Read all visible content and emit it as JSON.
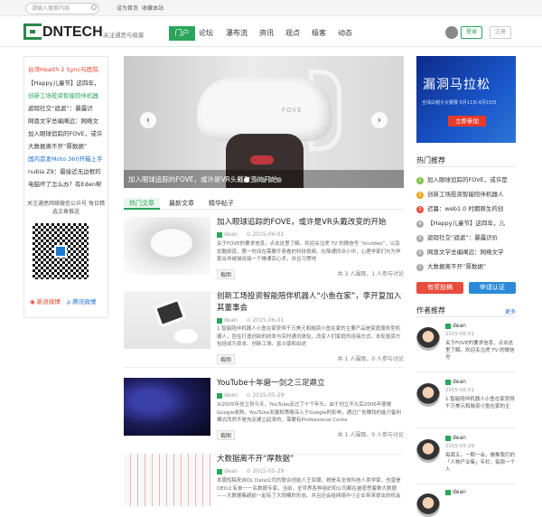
{
  "topbar": {
    "search_placeholder": "请输入搜索内容",
    "links": [
      "设为首页",
      "收藏本站"
    ]
  },
  "header": {
    "logo": "DNTECH",
    "slogan": "关注通思与极客",
    "nav": [
      "门户",
      "论坛",
      "瀑布流",
      "资讯",
      "观点",
      "极客",
      "动态"
    ],
    "login": "登录",
    "register": "注册"
  },
  "left": {
    "lines": [
      {
        "text": "台湾Health 2 Sync与医院",
        "color": "#e8422e"
      },
      {
        "text": "【Happy儿童节】这四年，",
        "color": "#333333"
      },
      {
        "text": "创新工场投资智能陪伴机器",
        "color": "#2aa55a"
      },
      {
        "text": "遮瑕社交“遮遮”：暴露识",
        "color": "#333333"
      },
      {
        "text": "网恩文学总编阐远：网络文",
        "color": "#333333"
      },
      {
        "text": "加入眼球追踪的FOVE，或许",
        "color": "#333333"
      },
      {
        "text": "大数据离不开“厚数据”",
        "color": "#333333"
      },
      {
        "text": "国内首发Moto 360开箱上手",
        "color": "#1b6fd0"
      },
      {
        "text": "nubia Z9：最接近无边框的",
        "color": "#333333"
      },
      {
        "text": "电脑坏了怎么办？有Eden帮",
        "color": "#333333"
      }
    ],
    "wechat_title": "关注通思网络微信公众号 每日精选文章推送",
    "weibo": "新浪微博",
    "tweibo": "腾讯微博"
  },
  "slider": {
    "caption": "加入眼球追踪的FOVE，或许是VR头戴改变的开始",
    "brand": "FOVE",
    "prev": "‹",
    "next": "›"
  },
  "tabs": [
    "热门文章",
    "最新文章",
    "精华帖子"
  ],
  "articles": [
    {
      "title": "加入眼球追踪的FOVE，或许是VR头戴改变的开始",
      "author": "dean",
      "date": "2015-06-01",
      "desc": "关于FOVE的要求信息，点击这里了解。欢迎关注虎 TV 的微信号 “knvideo”，以及优酷频道，第一时间在需要开奇看的科技视频。在降通同众小中，心理学家们与为学家合伴被描连接一个睡通实心术，并且习惯地",
      "tag": "截图",
      "stats": "共 3 人围观，1 人参与讨论"
    },
    {
      "title": "创新工场投资智能陪伴机器人“小鱼在家”，李开复加入其董事会",
      "author": "dean",
      "date": "2015-06-01",
      "desc": "1.智能陪伴机器人小鱼在家获得千万美元和融资小鱼在家的主要产品是家庭服务型机器人，旨在打造创新的研发与实时通讯体验，改变人们家庭的连接方式。本轮投资方包括成为资本、创新工场、富士康和出途",
      "tag": "截图",
      "stats": "共 1 人围观，0 人参与讨论"
    },
    {
      "title": "YouTube十年磨一剑之三足鼎立",
      "author": "dean",
      "date": "2015-05-29",
      "desc": "从2005年创立到今天，YouTube走过了十个年头。由于创立不久后2006年便被Google收购，YouTube发展和策略深入于Google的影响，通过广告赚钱的能力备利模式而然不是充足建立起来的，需要有Professional Conte",
      "tag": "截图",
      "stats": "共 1 人围观，0 人参与讨论"
    },
    {
      "title": "大数据离不开“厚数据”",
      "author": "dean",
      "date": "2015-05-29",
      "desc": "本篇短稿来自DL Data公司的联合创始人王亚娜，她是名全球科技人类学家，也曾是DEO上有单一一名数据专家。当前，全世界各种组织和公司都在被密思着数大数据——大数据集超前一起有了大规模的形态。并且还会给网络中小企业带来提出的机会",
      "tag": "截图",
      "stats": ""
    }
  ],
  "ad": {
    "title": "漏洞马拉松",
    "sub": "全球白帽子大赛赛 5月11日-6月15日",
    "cta": "立即参加"
  },
  "hot": {
    "heading": "热门推荐",
    "items": [
      {
        "n": "1",
        "text": "加入眼球追踪的FOVE，或许是",
        "c": "#7cc242"
      },
      {
        "n": "2",
        "text": "创新工场投资智能陪伴机器人",
        "c": "#f3a21b"
      },
      {
        "n": "3",
        "text": "迟暮：web1.0 时期原生的创",
        "c": "#e84c3d"
      },
      {
        "n": "4",
        "text": "【Happy儿童节】这四年，儿",
        "c": "#aaaaaa"
      },
      {
        "n": "5",
        "text": "遮瑕社交“遮遮”：暴露识价",
        "c": "#aaaaaa"
      },
      {
        "n": "6",
        "text": "网恩文学总编阐远：网络文学",
        "c": "#aaaaaa"
      },
      {
        "n": "7",
        "text": "大数据离不开“厚数据”",
        "c": "#aaaaaa"
      }
    ],
    "btn_review": "有奖投稿",
    "btn_apply": "申请认证"
  },
  "authors": {
    "heading": "作者推荐",
    "more": "更多",
    "items": [
      {
        "name": "dean",
        "date": "2015-06-01",
        "desc": "关于FOVE的要求信息，点击这里了解。欢迎关注虎 TV 的微信号"
      },
      {
        "name": "dean",
        "date": "2015-06-01",
        "desc": "1.智能陪伴机器人小鱼在家获得千万美元和融资小鱼在家的主"
      },
      {
        "name": "dean",
        "date": "2015-05-29",
        "desc": "每周五，一期一会，做推我们的「人物产业集」专栏，每周一个人"
      },
      {
        "name": "dean",
        "date": "",
        "desc": ""
      }
    ]
  }
}
